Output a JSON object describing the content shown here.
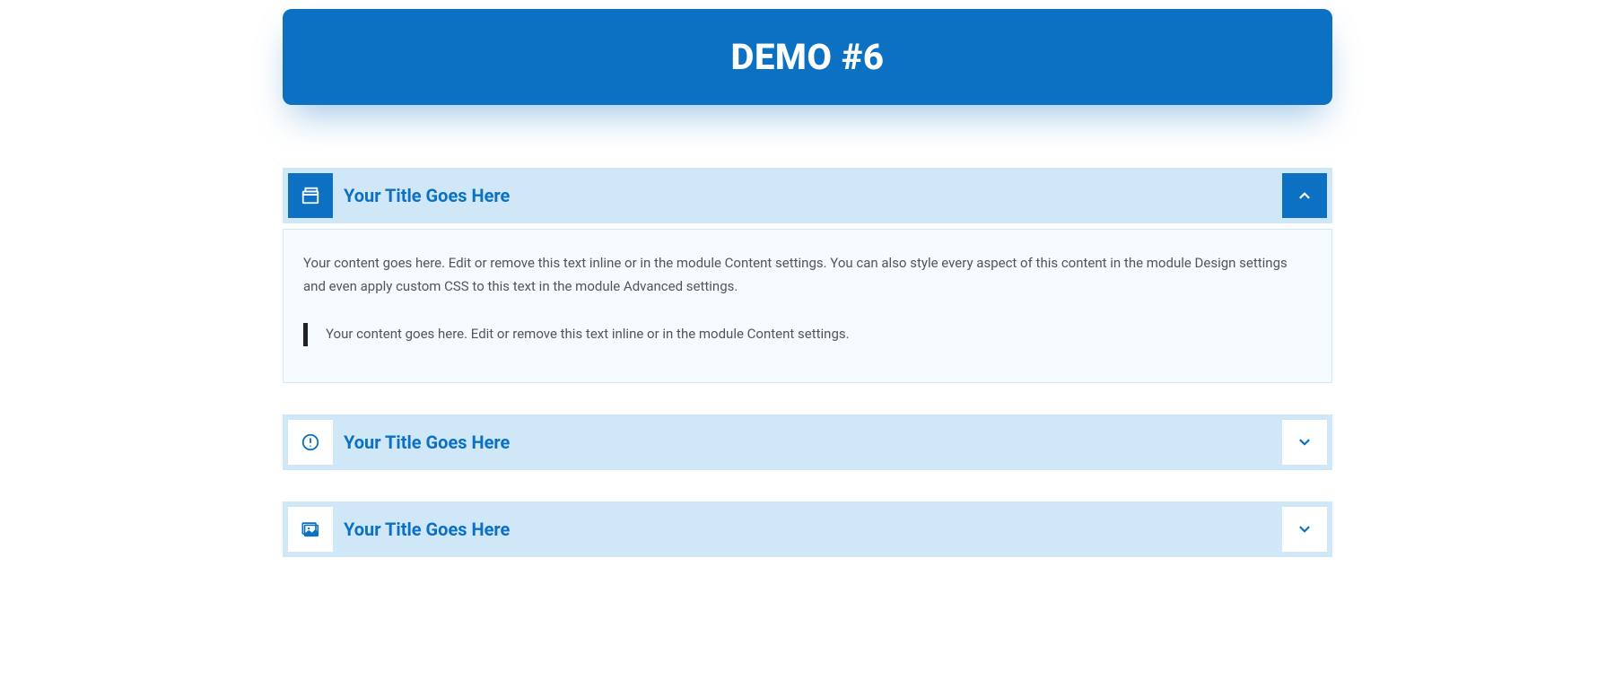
{
  "header": {
    "title": "DEMO #6"
  },
  "accordion": {
    "items": [
      {
        "title": "Your Title Goes Here",
        "icon": "window-icon",
        "expanded": true,
        "content": {
          "paragraph": "Your content goes here. Edit or remove this text inline or in the module Content settings. You can also style every aspect of this content in the module Design settings and even apply custom CSS to this text in the module Advanced settings.",
          "quote": "Your content goes here. Edit or remove this text inline or in the module Content settings."
        }
      },
      {
        "title": "Your Title Goes Here",
        "icon": "alert-icon",
        "expanded": false
      },
      {
        "title": "Your Title Goes Here",
        "icon": "image-icon",
        "expanded": false
      }
    ]
  },
  "colors": {
    "primary": "#0c71c3",
    "light": "#d0e7f7",
    "bodyBg": "#f5fbff"
  }
}
